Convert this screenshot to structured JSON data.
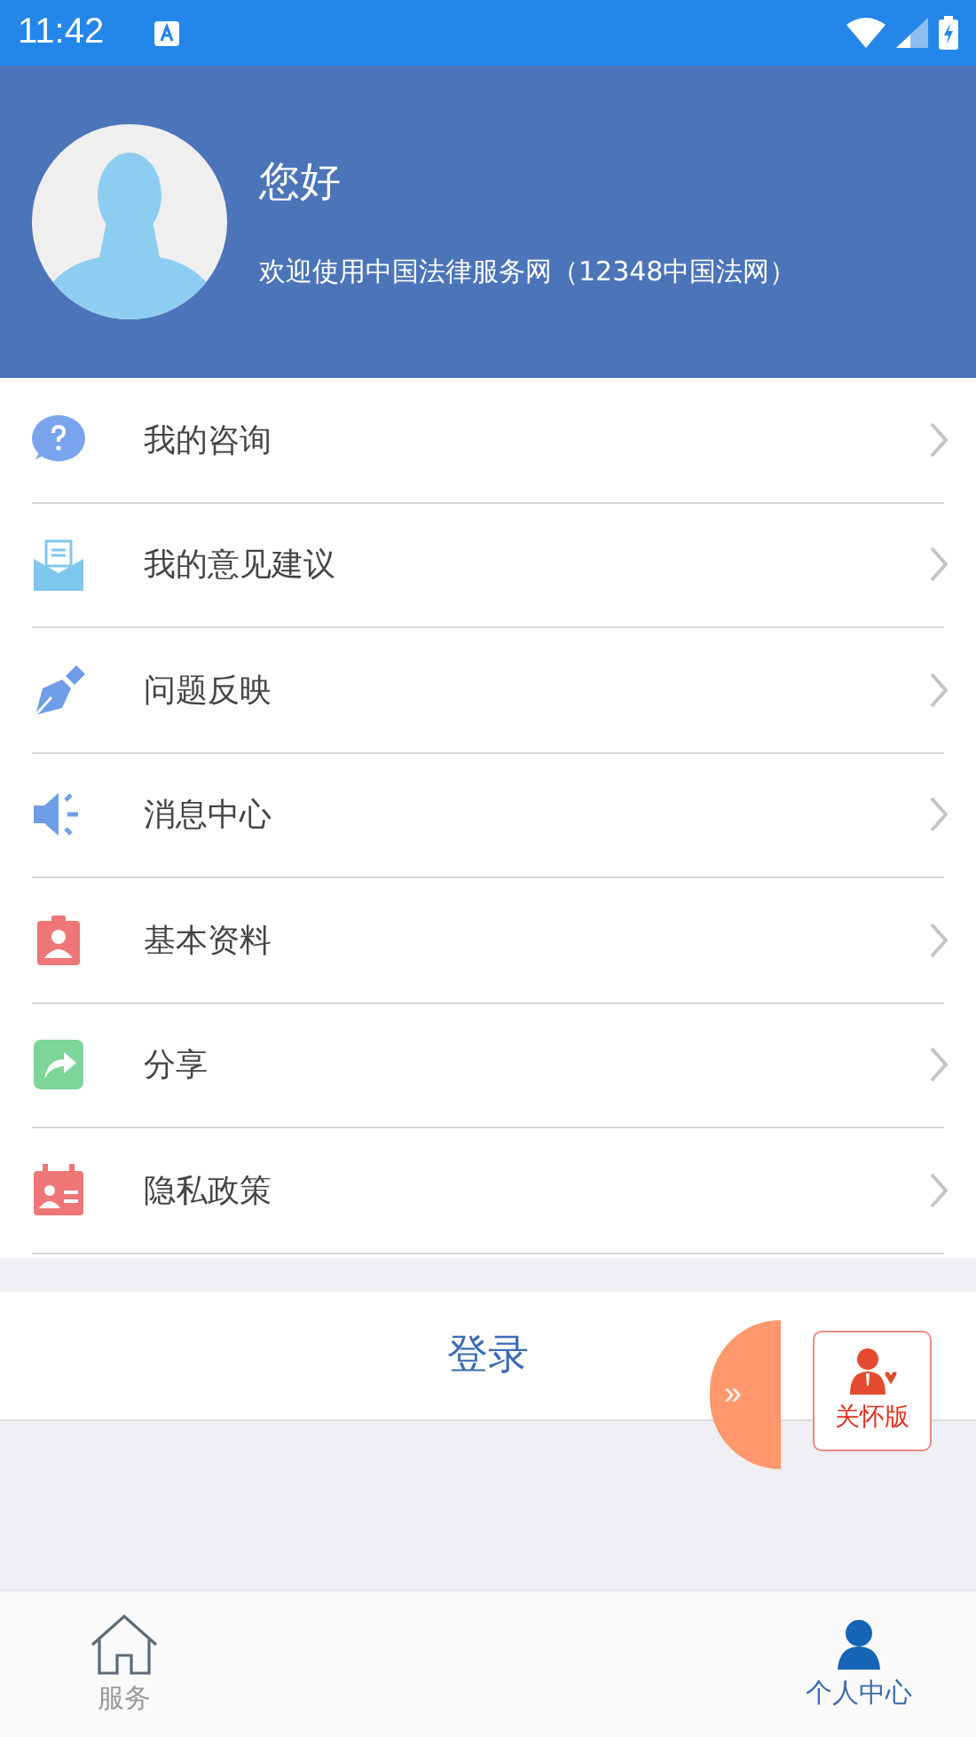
{
  "status_bar": {
    "time": "11:42"
  },
  "header": {
    "greeting": "您好",
    "welcome": "欢迎使用中国法律服务网（12348中国法网）"
  },
  "menu": [
    {
      "kind": "question",
      "label": "我的咨询"
    },
    {
      "kind": "mail",
      "label": "我的意见建议"
    },
    {
      "kind": "pen",
      "label": "问题反映"
    },
    {
      "kind": "speaker",
      "label": "消息中心"
    },
    {
      "kind": "badge",
      "label": "基本资料"
    },
    {
      "kind": "share",
      "label": "分享"
    },
    {
      "kind": "calendar",
      "label": "隐私政策"
    }
  ],
  "login_button": "登录",
  "floating": {
    "expand": "»",
    "care_mode": "关怀版"
  },
  "bottom_nav": [
    {
      "kind": "home",
      "label": "服务",
      "selected": false
    },
    {
      "kind": "person",
      "label": "个人中心",
      "selected": true
    }
  ]
}
